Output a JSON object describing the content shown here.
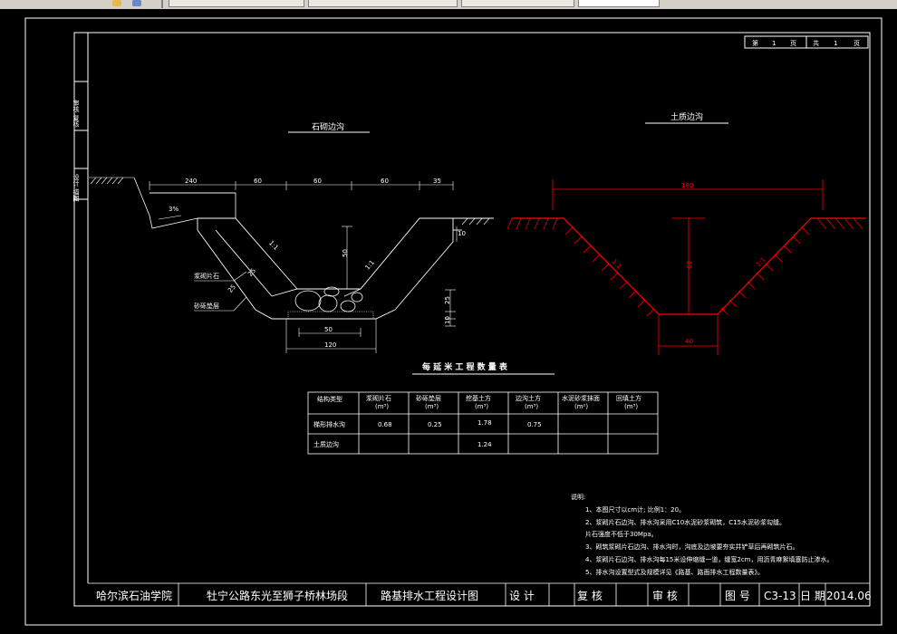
{
  "window": {
    "toolbar_tabs": [
      "",
      "",
      "",
      ""
    ]
  },
  "sheet": {
    "page_no_prefix": "第",
    "page_no": "1",
    "page_unit": "页",
    "total_prefix": "共",
    "total": "1",
    "total_unit": "页",
    "left_strip_top": "审核 复核",
    "left_strip_bottom": "设计 描图"
  },
  "stone_ditch": {
    "title": "石砌边沟",
    "dims_top": [
      "240",
      "60",
      "60",
      "60",
      "35"
    ],
    "slope_small": "3%",
    "depth": "50",
    "side_slope_left": "1:1",
    "side_slope_right": "1:1",
    "wall_thk": "25",
    "bottom_thk": "25",
    "bottom_width_inner": "50",
    "bottom_width_outer": "120",
    "callout_masonry": "浆砌片石",
    "callout_gravel": "砂砾垫层",
    "base_thk": "10",
    "right_side": "10"
  },
  "soil_ditch": {
    "title": "土质边沟",
    "top_width": "180",
    "depth": "60",
    "bottom_width": "40",
    "slope_left": "1:1",
    "slope_right": "1:1"
  },
  "quantity_table": {
    "title": "每 延 米 工 程 数 量 表",
    "headers": [
      {
        "name": "结构类型",
        "unit": ""
      },
      {
        "name": "浆砌片石",
        "unit": "(m³)"
      },
      {
        "name": "砂砾垫层",
        "unit": "(m³)"
      },
      {
        "name": "挖基土方",
        "unit": "(m³)"
      },
      {
        "name": "边沟土方",
        "unit": "(m³)"
      },
      {
        "name": "水泥砂浆抹面",
        "unit": "(m²)"
      },
      {
        "name": "回填土方",
        "unit": "(m³)"
      }
    ],
    "rows": [
      [
        "梯形排水沟",
        "0.68",
        "0.25",
        "1.78",
        "0.75",
        "",
        ""
      ],
      [
        "土质边沟",
        "",
        "",
        "1.24",
        "",
        "",
        ""
      ]
    ]
  },
  "notes": {
    "heading": "说明:",
    "items": [
      "1、本图尺寸以cm计; 比例1：20。",
      "2、浆砌片石边沟、排水沟采用C10水泥砂浆砌筑，C15水泥砂浆勾缝。",
      "   片石强度不低于30Mpa。",
      "3、砌筑浆砌片石边沟、排水沟时，沟底及边坡要夯实并铲草后再砌筑片石。",
      "4、浆砌片石边沟、排水沟每15米设伸缩缝一道，缝宽2cm，用沥青麻絮填塞防止渗水。",
      "5、排水沟设置型式及规模详见《路基、路面排水工程数量表》。"
    ]
  },
  "title_block": {
    "school": "哈尔滨石油学院",
    "project": "牡宁公路东光至狮子桥林场段",
    "drawing": "路基排水工程设计图",
    "design": "设 计",
    "check": "复 核",
    "review": "审 核",
    "figno_label": "图 号",
    "figno": "C3-13",
    "date_label": "日 期",
    "date": "2014.06"
  }
}
